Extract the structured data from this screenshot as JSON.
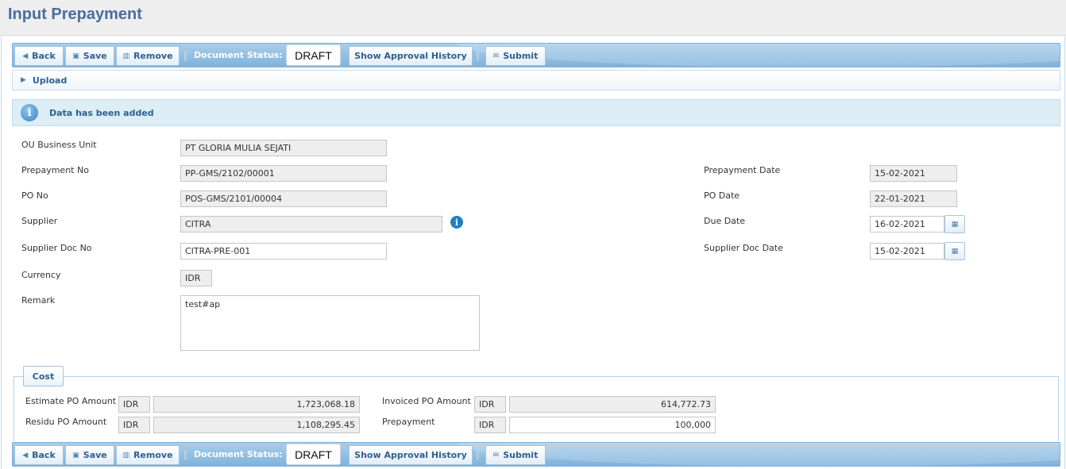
{
  "page": {
    "title": "Input Prepayment"
  },
  "toolbar": {
    "back_label": "Back",
    "save_label": "Save",
    "remove_label": "Remove",
    "status_label": "Document Status:",
    "status_value": "DRAFT",
    "approval_label": "Show Approval History",
    "submit_label": "Submit"
  },
  "upload": {
    "label": "Upload"
  },
  "message": {
    "text": "Data has been added"
  },
  "form": {
    "ou_label": "OU Business Unit",
    "ou_value": "PT GLORIA MULIA SEJATI",
    "prepayment_no_label": "Prepayment No",
    "prepayment_no_value": "PP-GMS/2102/00001",
    "po_no_label": "PO No",
    "po_no_value": "POS-GMS/2101/00004",
    "supplier_label": "Supplier",
    "supplier_value": "CITRA",
    "supplier_doc_no_label": "Supplier Doc No",
    "supplier_doc_no_value": "CITRA-PRE-001",
    "currency_label": "Currency",
    "currency_value": "IDR",
    "remark_label": "Remark",
    "remark_value": "test#ap",
    "prepayment_date_label": "Prepayment Date",
    "prepayment_date_value": "15-02-2021",
    "po_date_label": "PO Date",
    "po_date_value": "22-01-2021",
    "due_date_label": "Due Date",
    "due_date_value": "16-02-2021",
    "supplier_doc_date_label": "Supplier Doc Date",
    "supplier_doc_date_value": "15-02-2021"
  },
  "cost": {
    "legend": "Cost",
    "estimate_label": "Estimate PO Amount",
    "estimate_currency": "IDR",
    "estimate_value": "1,723,068.18",
    "residu_label": "Residu PO Amount",
    "residu_currency": "IDR",
    "residu_value": "1,108,295.45",
    "invoiced_label": "Invoiced PO Amount",
    "invoiced_currency": "IDR",
    "invoiced_value": "614,772.73",
    "prepayment_label": "Prepayment",
    "prepayment_currency": "IDR",
    "prepayment_value": "100,000"
  },
  "icons": {
    "back": "caret-left-icon",
    "save": "floppy-disk-icon",
    "remove": "trash-icon",
    "submit": "envelope-icon",
    "upload": "caret-right-icon",
    "info": "info-icon",
    "calendar": "calendar-icon"
  }
}
